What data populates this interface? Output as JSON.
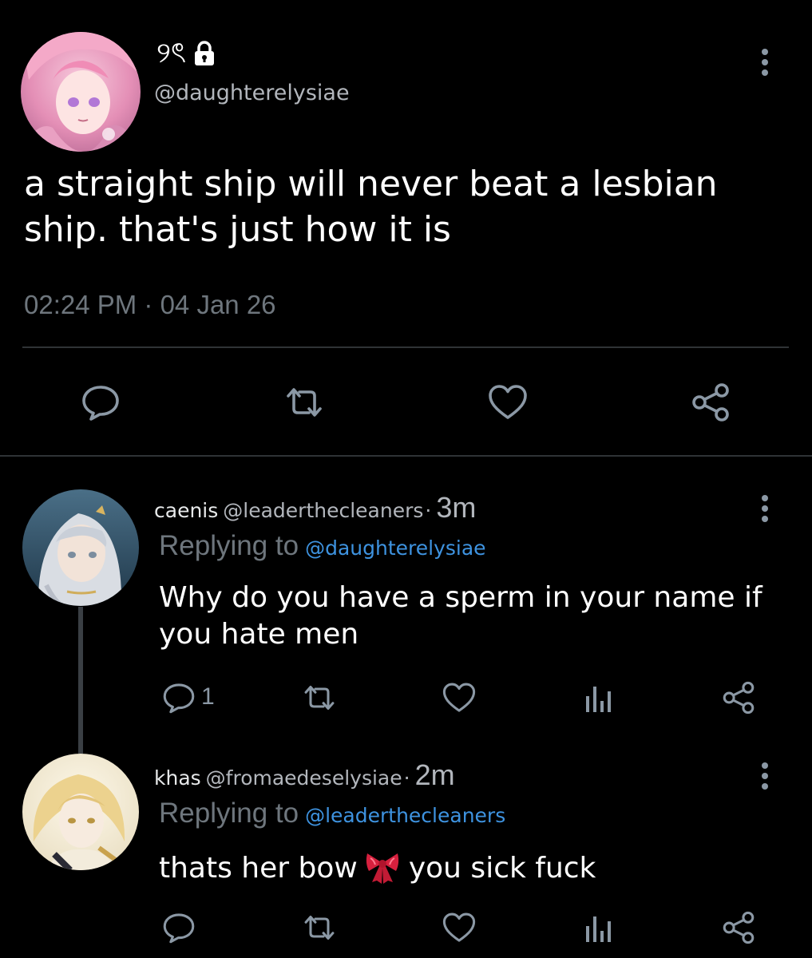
{
  "main_tweet": {
    "display_name_glyphs": "୨ৎ",
    "handle": "@daughterelysiae",
    "text": "a straight ship will never beat a lesbian ship. that's just how it is",
    "timestamp": "02:24 PM · 04 Jan 26",
    "icons": [
      "lock-icon",
      "more-vert-icon",
      "comment-icon",
      "retweet-icon",
      "like-icon",
      "share-icon"
    ]
  },
  "replies": [
    {
      "name": "caenis",
      "handle": "@leaderthecleaners",
      "dot": "·",
      "time": "3m",
      "replying_label": "Replying to",
      "replying_handle": "@daughterelysiae",
      "text": "Why do you have a sperm in your name if you hate men",
      "comment_count": "1"
    },
    {
      "name": "khas",
      "handle": "@fromaedeselysiae",
      "dot": "·",
      "time": "2m",
      "replying_label": "Replying to",
      "replying_handle": "@leaderthecleaners",
      "text_before": "thats her bow",
      "text_after": "you sick fuck",
      "emoji": "ribbon-bow-icon"
    }
  ],
  "colors": {
    "background": "#000000",
    "text": "#ffffff",
    "secondary": "#6e767d",
    "handle": "#b2b6bc",
    "link": "#3e93e0",
    "divider": "#2f3336",
    "icon": "#8b98a5"
  }
}
